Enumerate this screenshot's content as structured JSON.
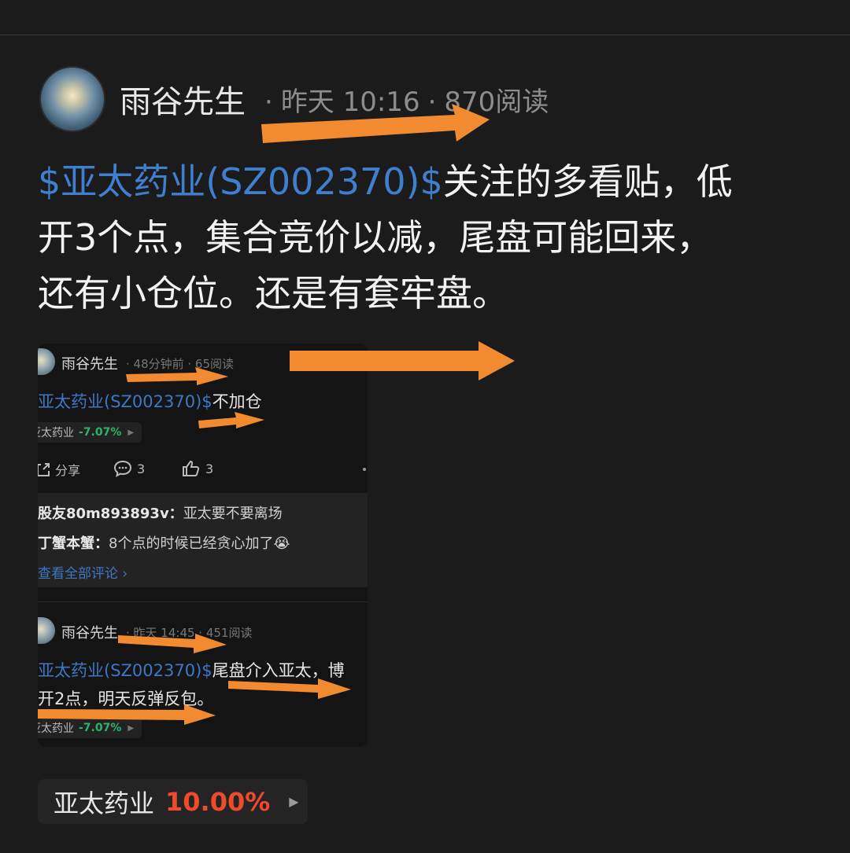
{
  "post": {
    "author": "雨谷先生",
    "time": "昨天 10:16",
    "reads": "870阅读",
    "stock_link": "$亚太药业(SZ002370)$",
    "text_line1": "关注的多看贴，低",
    "text_line2": "开3个点，集合竞价以减，尾盘可能回来，",
    "text_line3": "还有小仓位。还是有套牢盘。"
  },
  "embedded": {
    "post1": {
      "author": "雨谷先生",
      "meta": "· 48分钟前 · 65阅读",
      "stock_link": "亚太药业(SZ002370)$",
      "text": "不加仓",
      "tag_name": "亚太药业",
      "tag_pct": "-7.07%",
      "share": "分享",
      "comment_count": "3",
      "like_count": "3"
    },
    "comments": [
      {
        "user": "股友80m893893v：",
        "text": "亚太要不要离场"
      },
      {
        "user": "丁蟹本蟹：",
        "text": "8个点的时候已经贪心加了😭"
      }
    ],
    "view_all": "查看全部评论",
    "post2": {
      "author": "雨谷先生",
      "meta": "· 昨天 14:45 · 451阅读",
      "stock_link": "亚太药业(SZ002370)$",
      "text_line1": "尾盘介入亚太，博",
      "text_line2": "开2点，明天反弹反包。",
      "tag_name": "亚太药业",
      "tag_pct": "-7.07%"
    }
  },
  "stock_tag": {
    "name": "亚太药业",
    "pct": "10.00%"
  },
  "colors": {
    "background": "#1b1b1b",
    "link": "#3f7fd0",
    "up": "#f04a2a",
    "down": "#2fb36a",
    "arrow": "#f28a30"
  }
}
